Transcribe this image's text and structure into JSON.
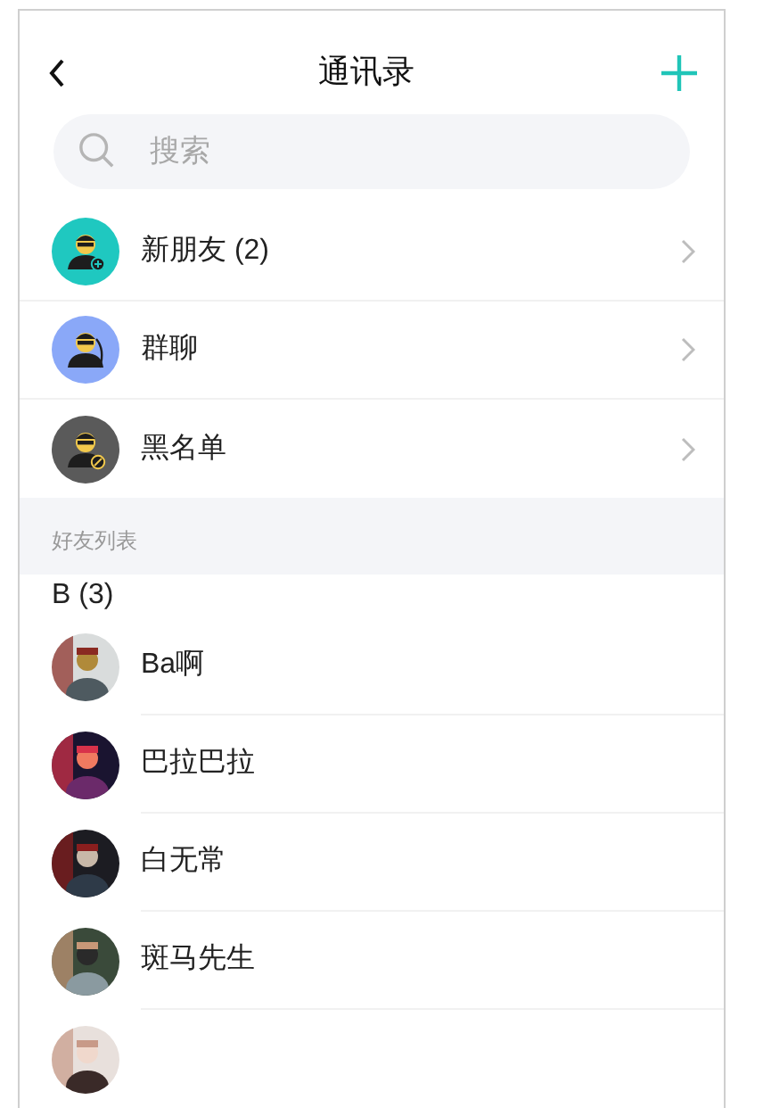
{
  "header": {
    "title": "通讯录"
  },
  "search": {
    "placeholder": "搜索"
  },
  "entries": [
    {
      "label": "新朋友 (2)",
      "color": "#1fc8c0",
      "kind": "plus"
    },
    {
      "label": "群聊",
      "color": "#8aa8f8",
      "kind": "group"
    },
    {
      "label": "黑名单",
      "color": "#5a5a5a",
      "kind": "block"
    }
  ],
  "section_title": "好友列表",
  "groups": [
    {
      "letter": "B (3)",
      "contacts": [
        {
          "name": "Ba啊",
          "kind": "picture"
        },
        {
          "name": "巴拉巴拉",
          "kind": "picture"
        },
        {
          "name": "白无常",
          "kind": "picture"
        },
        {
          "name": "斑马先生",
          "kind": "picture"
        },
        {
          "kind": "picture"
        }
      ]
    }
  ]
}
